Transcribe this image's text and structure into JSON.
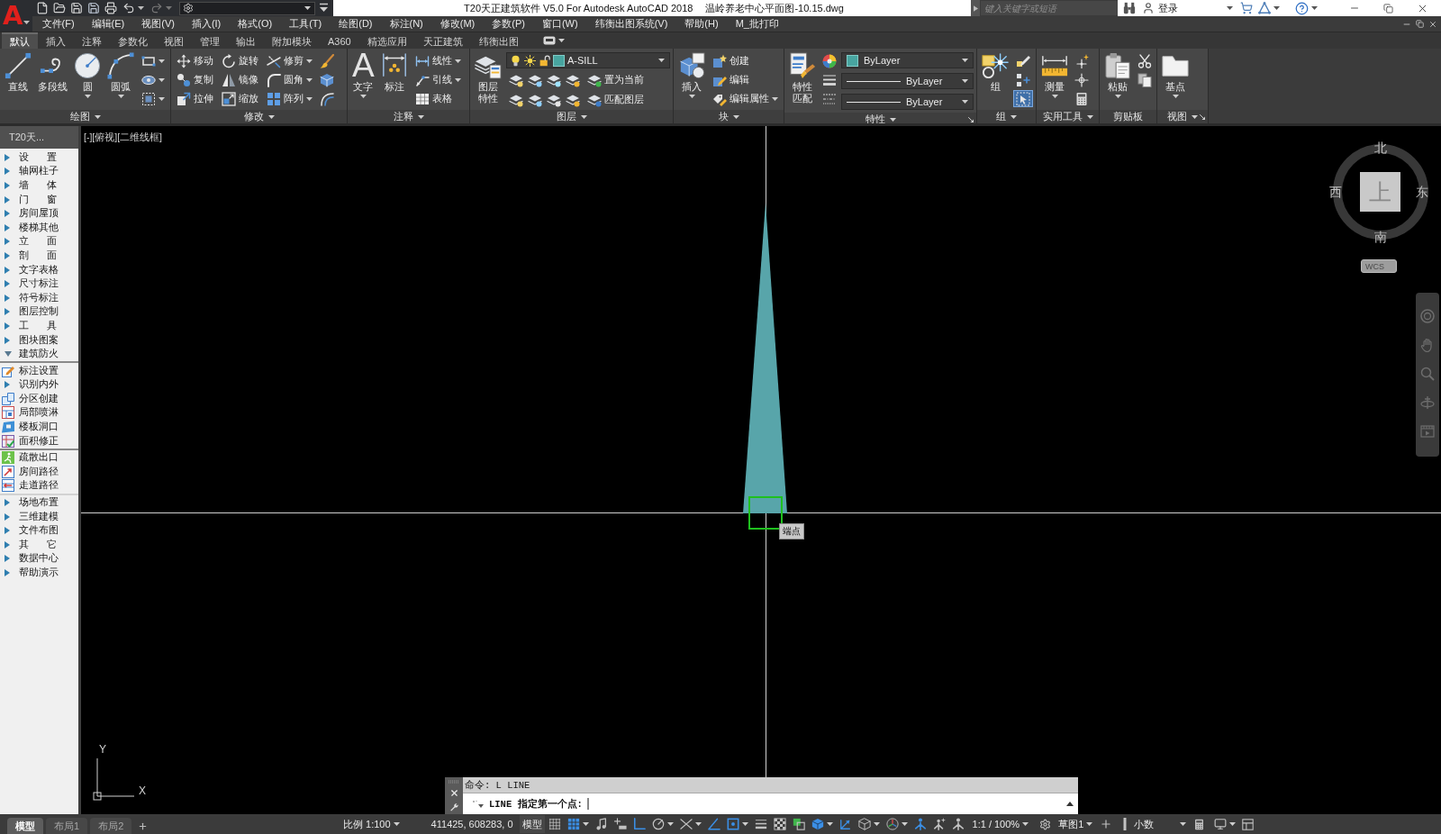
{
  "app_button": {
    "label": "A"
  },
  "window": {
    "title": "T20天正建筑软件 V5.0 For Autodesk AutoCAD 2018",
    "document": "温岭养老中心平面图-10.15.dwg"
  },
  "search": {
    "placeholder": "键入关键字或短语"
  },
  "account": {
    "label": "登录"
  },
  "menu_bar": [
    "文件(F)",
    "编辑(E)",
    "视图(V)",
    "插入(I)",
    "格式(O)",
    "工具(T)",
    "绘图(D)",
    "标注(N)",
    "修改(M)",
    "参数(P)",
    "窗口(W)",
    "纬衡出图系统(V)",
    "帮助(H)",
    "M_批打印"
  ],
  "ribbon": {
    "tabs": [
      {
        "label": "默认",
        "selected": true
      },
      {
        "label": "插入",
        "selected": false
      },
      {
        "label": "注释",
        "selected": false
      },
      {
        "label": "参数化",
        "selected": false
      },
      {
        "label": "视图",
        "selected": false
      },
      {
        "label": "管理",
        "selected": false
      },
      {
        "label": "输出",
        "selected": false
      },
      {
        "label": "附加模块",
        "selected": false
      },
      {
        "label": "A360",
        "selected": false
      },
      {
        "label": "精选应用",
        "selected": false
      },
      {
        "label": "天正建筑",
        "selected": false
      },
      {
        "label": "纬衡出图",
        "selected": false
      }
    ],
    "panels": [
      {
        "title": "绘图",
        "dropdown": true,
        "launcher": false,
        "columns": [
          {
            "kind": "large",
            "label": "直线",
            "dropdown": false
          },
          {
            "kind": "large",
            "label": "多段线",
            "dropdown": false
          },
          {
            "kind": "large",
            "label": "圆",
            "dropdown": true
          },
          {
            "kind": "large",
            "label": "圆弧",
            "dropdown": true
          },
          {
            "kind": "stack",
            "rows": [
              {
                "dropdown": true
              },
              {
                "dropdown": true
              },
              {
                "dropdown": true
              }
            ]
          }
        ]
      },
      {
        "title": "修改",
        "dropdown": true,
        "launcher": false,
        "columns": [
          {
            "kind": "stack",
            "rows": [
              {
                "label": "移动",
                "dropdown": false
              },
              {
                "label": "复制",
                "dropdown": false
              },
              {
                "label": "拉伸",
                "dropdown": false
              }
            ]
          },
          {
            "kind": "stack",
            "rows": [
              {
                "label": "旋转",
                "dropdown": false
              },
              {
                "label": "镜像",
                "dropdown": false
              },
              {
                "label": "缩放",
                "dropdown": false
              }
            ]
          },
          {
            "kind": "stack",
            "rows": [
              {
                "label": "修剪",
                "dropdown": true
              },
              {
                "label": "圆角",
                "dropdown": true
              },
              {
                "label": "阵列",
                "dropdown": true
              }
            ]
          },
          {
            "kind": "stack",
            "rows": [
              {
                "dropdown": false
              },
              {
                "dropdown": false
              },
              {
                "dropdown": false
              }
            ]
          }
        ]
      },
      {
        "title": "注释",
        "dropdown": true,
        "launcher": false,
        "columns": [
          {
            "kind": "large",
            "label": "文字",
            "glyph": "A",
            "dropdown": true
          },
          {
            "kind": "large",
            "label": "标注",
            "dropdown": false
          },
          {
            "kind": "stack",
            "rows": [
              {
                "label": "线性",
                "dropdown": true
              },
              {
                "label": "引线",
                "dropdown": true
              },
              {
                "label": "表格",
                "dropdown": false
              }
            ]
          }
        ]
      },
      {
        "title": "图层",
        "dropdown": true,
        "launcher": false,
        "columns": [
          {
            "kind": "large",
            "label": "图层特性",
            "dropdown": false
          },
          {
            "kind": "layer",
            "value": "A-SILL",
            "rows": [
              {
                "label": "置为当前"
              },
              {
                "label": "匹配图层"
              }
            ]
          }
        ]
      },
      {
        "title": "块",
        "dropdown": true,
        "launcher": false,
        "columns": [
          {
            "kind": "large",
            "label": "插入",
            "dropdown": true
          },
          {
            "kind": "stack",
            "rows": [
              {
                "label": "创建",
                "dropdown": false
              },
              {
                "label": "编辑",
                "dropdown": false
              },
              {
                "label": "编辑属性",
                "dropdown": true
              }
            ]
          }
        ]
      },
      {
        "title": "特性",
        "dropdown": true,
        "launcher": true,
        "columns": [
          {
            "kind": "large",
            "label": "特性匹配",
            "dropdown": false
          },
          {
            "kind": "stack",
            "rows": [
              {
                "dropdown": false
              },
              {
                "dropdown": false
              },
              {
                "dropdown": false
              }
            ]
          },
          {
            "kind": "combos",
            "combos": [
              {
                "kind": "color",
                "value": "ByLayer"
              },
              {
                "kind": "line",
                "value": "ByLayer"
              },
              {
                "kind": "line",
                "value": "ByLayer"
              }
            ]
          }
        ]
      },
      {
        "title": "组",
        "dropdown": true,
        "launcher": false,
        "columns": [
          {
            "kind": "large",
            "label": "组",
            "dropdown": false
          },
          {
            "kind": "stack",
            "rows": [
              {
                "dropdown": false,
                "on": false
              },
              {
                "dropdown": false,
                "on": false
              },
              {
                "dropdown": false,
                "on": true
              }
            ]
          }
        ]
      },
      {
        "title": "实用工具",
        "dropdown": true,
        "launcher": false,
        "columns": [
          {
            "kind": "large",
            "label": "测量",
            "dropdown": true
          },
          {
            "kind": "stack",
            "rows": [
              {
                "dropdown": false
              },
              {
                "dropdown": false
              },
              {
                "dropdown": false
              }
            ]
          }
        ]
      },
      {
        "title": "剪贴板",
        "dropdown": false,
        "launcher": false,
        "columns": [
          {
            "kind": "large",
            "label": "粘贴",
            "dropdown": true
          },
          {
            "kind": "stack",
            "rows": [
              {
                "dropdown": false
              },
              {
                "dropdown": false
              }
            ]
          }
        ]
      },
      {
        "title": "视图",
        "dropdown": true,
        "launcher": true,
        "columns": [
          {
            "kind": "large",
            "label": "基点",
            "dropdown": true
          }
        ]
      }
    ]
  },
  "sidebar": {
    "title": "T20天...",
    "items": [
      {
        "label": "设 置",
        "expanded": false
      },
      {
        "label": "轴网柱子",
        "expanded": false
      },
      {
        "label": "墙 体",
        "expanded": false
      },
      {
        "label": "门 窗",
        "expanded": false
      },
      {
        "label": "房间屋顶",
        "expanded": false
      },
      {
        "label": "楼梯其他",
        "expanded": false
      },
      {
        "label": "立 面",
        "expanded": false
      },
      {
        "label": "剖 面",
        "expanded": false
      },
      {
        "label": "文字表格",
        "expanded": false
      },
      {
        "label": "尺寸标注",
        "expanded": false
      },
      {
        "label": "符号标注",
        "expanded": false
      },
      {
        "label": "图层控制",
        "expanded": false
      },
      {
        "label": "工 具",
        "expanded": false
      },
      {
        "label": "图块图案",
        "expanded": false
      },
      {
        "label": "建筑防火",
        "expanded": true,
        "groups": [
          {
            "items": [
              {
                "label": "标注设置",
                "kind": "command"
              },
              {
                "label": "识别内外",
                "kind": "folder",
                "expanded": false
              },
              {
                "label": "分区创建",
                "kind": "command"
              },
              {
                "label": "局部喷淋",
                "kind": "command"
              },
              {
                "label": "楼板洞口",
                "kind": "command"
              },
              {
                "label": "面积修正",
                "kind": "command"
              }
            ]
          },
          {
            "items": [
              {
                "label": "疏散出口",
                "kind": "command"
              },
              {
                "label": "房间路径",
                "kind": "command"
              },
              {
                "label": "走道路径",
                "kind": "command"
              }
            ]
          }
        ]
      },
      {
        "label": "场地布置",
        "expanded": false
      },
      {
        "label": "三维建模",
        "expanded": false
      },
      {
        "label": "文件布图",
        "expanded": false
      },
      {
        "label": "其 它",
        "expanded": false
      },
      {
        "label": "数据中心",
        "expanded": false
      },
      {
        "label": "帮助演示",
        "expanded": false
      }
    ]
  },
  "viewport": {
    "controls": [
      "[-]",
      "[俯视]",
      "[二维线框]"
    ],
    "snap_tooltip": "端点",
    "ucs": {
      "x": "X",
      "y": "Y"
    },
    "viewcube": {
      "north": "北",
      "south": "南",
      "west": "西",
      "east": "东",
      "face": "上",
      "coordinate_system": "WCS"
    }
  },
  "command_line": {
    "history": "命令: L LINE",
    "prompt": "LINE 指定第一个点:"
  },
  "layout_tabs": [
    {
      "label": "模型",
      "selected": true
    },
    {
      "label": "布局1",
      "selected": false
    },
    {
      "label": "布局2",
      "selected": false
    }
  ],
  "status_bar": {
    "scale": "比例 1:100",
    "coordinates": "411425, 608283, 0",
    "space": "模型",
    "toggles": [
      {
        "on": false,
        "dropdown": false
      },
      {
        "on": true,
        "dropdown": true
      },
      {
        "on": false,
        "dropdown": false
      },
      {
        "on": false,
        "dropdown": false
      },
      {
        "on": true,
        "dropdown": false
      },
      {
        "on": false,
        "dropdown": true
      },
      {
        "on": false,
        "dropdown": true
      },
      {
        "on": true,
        "dropdown": false
      },
      {
        "on": true,
        "dropdown": true
      },
      {
        "on": false,
        "dropdown": false
      },
      {
        "on": false,
        "dropdown": false
      },
      {
        "on": false,
        "dropdown": false
      },
      {
        "on": true,
        "dropdown": true
      },
      {
        "on": true,
        "dropdown": false
      },
      {
        "on": false,
        "dropdown": true
      },
      {
        "on": false,
        "dropdown": true
      },
      {
        "on": true,
        "dropdown": false
      },
      {
        "on": false,
        "dropdown": false
      },
      {
        "on": false,
        "dropdown": false
      }
    ],
    "annotation_scale": "1:1 / 100%",
    "workspace": "草图1",
    "units": "小数"
  }
}
